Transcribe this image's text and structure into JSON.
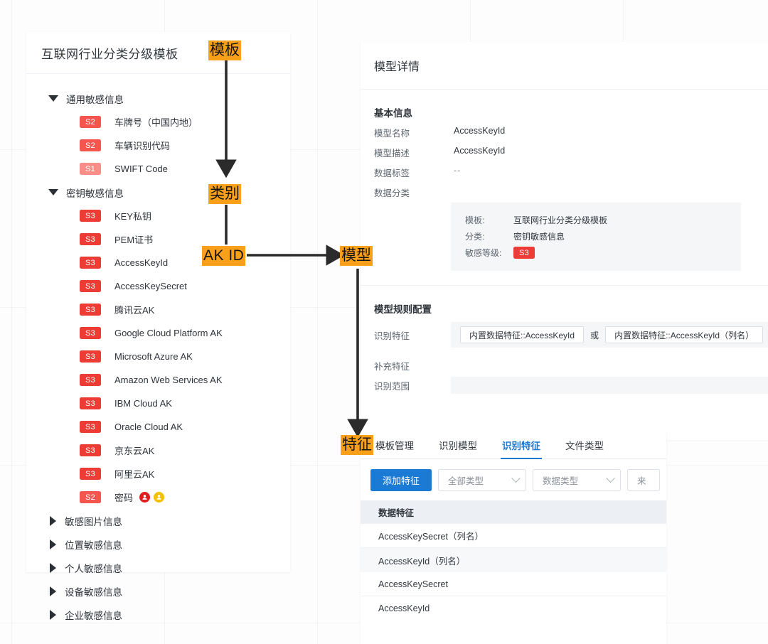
{
  "template_panel": {
    "title": "互联网行业分类分级模板",
    "groups": [
      {
        "label": "通用敏感信息",
        "expanded": true,
        "caret": "caret-down-icon",
        "items": [
          {
            "level": "S2",
            "label": "车牌号（中国内地）"
          },
          {
            "level": "S2",
            "label": "车辆识别代码"
          },
          {
            "level": "S1",
            "label": "SWIFT Code"
          }
        ]
      },
      {
        "label": "密钥敏感信息",
        "expanded": true,
        "caret": "caret-down-icon",
        "items": [
          {
            "level": "S3",
            "label": "KEY私钥"
          },
          {
            "level": "S3",
            "label": "PEM证书"
          },
          {
            "level": "S3",
            "label": "AccessKeyId"
          },
          {
            "level": "S3",
            "label": "AccessKeySecret"
          },
          {
            "level": "S3",
            "label": "腾讯云AK"
          },
          {
            "level": "S3",
            "label": "Google Cloud Platform AK"
          },
          {
            "level": "S3",
            "label": "Microsoft Azure AK"
          },
          {
            "level": "S3",
            "label": "Amazon Web Services AK"
          },
          {
            "level": "S3",
            "label": "IBM Cloud AK"
          },
          {
            "level": "S3",
            "label": "Oracle Cloud AK"
          },
          {
            "level": "S3",
            "label": "京东云AK"
          },
          {
            "level": "S3",
            "label": "阿里云AK"
          },
          {
            "level": "S2",
            "label": "密码",
            "icons": [
              "person-red-icon",
              "person-yellow-icon"
            ]
          }
        ]
      },
      {
        "label": "敏感图片信息",
        "expanded": false,
        "caret": "caret-right-icon",
        "items": []
      },
      {
        "label": "位置敏感信息",
        "expanded": false,
        "caret": "caret-right-icon",
        "items": []
      },
      {
        "label": "个人敏感信息",
        "expanded": false,
        "caret": "caret-right-icon",
        "items": []
      },
      {
        "label": "设备敏感信息",
        "expanded": false,
        "caret": "caret-right-icon",
        "items": []
      },
      {
        "label": "企业敏感信息",
        "expanded": false,
        "caret": "caret-right-icon",
        "items": []
      }
    ]
  },
  "detail_panel": {
    "title": "模型详情",
    "basic_section_title": "基本信息",
    "fields": [
      {
        "key": "模型名称",
        "value": "AccessKeyId"
      },
      {
        "key": "模型描述",
        "value": "AccessKeyId"
      },
      {
        "key": "数据标签",
        "value": "--"
      },
      {
        "key": "数据分类",
        "value": ""
      }
    ],
    "classification": [
      {
        "key": "模板:",
        "value": "互联网行业分类分级模板"
      },
      {
        "key": "分类:",
        "value": "密钥敏感信息"
      },
      {
        "key": "敏感等级:",
        "value": "S3",
        "is_badge": true
      }
    ],
    "rules_section_title": "模型规则配置",
    "rules": {
      "recognize_key": "识别特征",
      "chip_1": "内置数据特征::AccessKeyId",
      "conjunction": "或",
      "chip_2": "内置数据特征::AccessKeyId（列名）",
      "supplement_key": "补充特征",
      "scope_key": "识别范围"
    }
  },
  "bottom_panel": {
    "tabs": [
      {
        "label": "模板管理",
        "active": false
      },
      {
        "label": "识别模型",
        "active": false
      },
      {
        "label": "识别特征",
        "active": true
      },
      {
        "label": "文件类型",
        "active": false
      }
    ],
    "toolbar": {
      "add_button": "添加特征",
      "filter_type": "全部类型",
      "filter_data_type": "数据类型",
      "filter_source": "来"
    },
    "table": {
      "header": "数据特征",
      "rows": [
        "AccessKeySecret（列名）",
        "AccessKeyId（列名）",
        "AccessKeySecret",
        "AccessKeyId"
      ]
    }
  },
  "annotations": {
    "template": "模板",
    "category": "类别",
    "ak_id": "AK ID",
    "model": "模型",
    "feature": "特征"
  },
  "colors": {
    "accent_blue": "#1b7ad4",
    "annotation_orange": "#f9a01b",
    "level_s3": "#ec3c35",
    "level_s2": "#f4564f",
    "level_s1": "#f98d88"
  }
}
